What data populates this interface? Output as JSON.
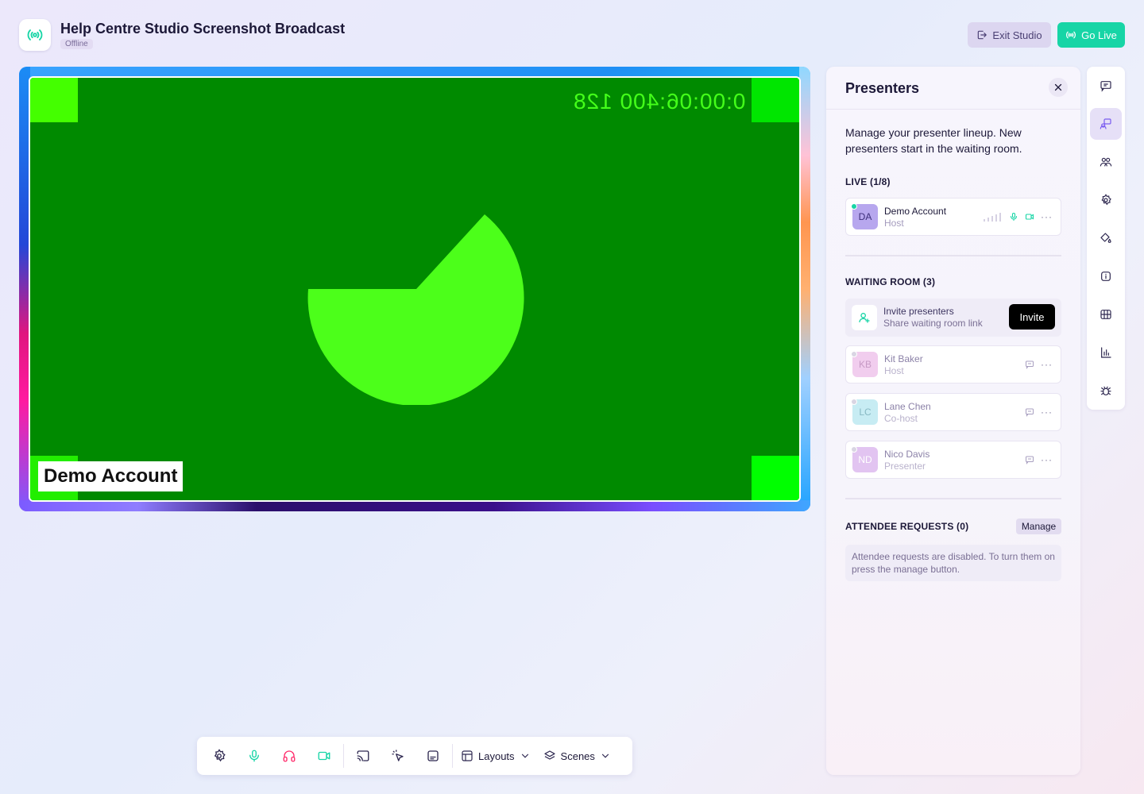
{
  "header": {
    "title": "Help Centre Studio Screenshot Broadcast",
    "status": "Offline",
    "exit_label": "Exit Studio",
    "golive_label": "Go Live",
    "logo_icon": "broadcast-icon"
  },
  "stage": {
    "timecode": "0:00:06:400 128",
    "name_tag": "Demo Account",
    "bg_color": "#008a00",
    "graphic_color": "#4cff1a"
  },
  "toolbar": {
    "items": [
      "settings-icon",
      "microphone-icon",
      "headphones-icon",
      "camera-icon",
      "cast-icon",
      "pointer-icon",
      "captions-icon"
    ],
    "layouts_label": "Layouts",
    "scenes_label": "Scenes"
  },
  "panel": {
    "title": "Presenters",
    "description": "Manage your presenter lineup. New presenters start in the waiting room.",
    "live": {
      "heading": "LIVE (1/8)",
      "presenters": [
        {
          "initials": "DA",
          "name": "Demo Account",
          "role": "Host"
        }
      ]
    },
    "waiting": {
      "heading": "WAITING ROOM (3)",
      "invite_title": "Invite presenters",
      "invite_subtitle": "Share waiting room link",
      "invite_button": "Invite",
      "presenters": [
        {
          "initials": "KB",
          "name": "Kit Baker",
          "role": "Host"
        },
        {
          "initials": "LC",
          "name": "Lane Chen",
          "role": "Co-host"
        },
        {
          "initials": "ND",
          "name": "Nico Davis",
          "role": "Presenter"
        }
      ]
    },
    "requests": {
      "heading": "ATTENDEE REQUESTS (0)",
      "manage_label": "Manage",
      "note": "Attendee requests are disabled. To turn them on press the manage button."
    }
  },
  "rail": {
    "items": [
      "chat-icon",
      "presenters-icon",
      "people-icon",
      "settings-icon",
      "brand-icon",
      "info-icon",
      "media-icon",
      "analytics-icon",
      "debug-icon"
    ],
    "active": "presenters-icon"
  },
  "colors": {
    "accent": "#17d5a6",
    "muted_purple": "#8c82a8"
  }
}
